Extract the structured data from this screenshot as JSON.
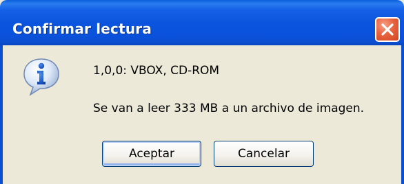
{
  "window": {
    "title": "Confirmar lectura"
  },
  "message": {
    "line1": "1,0,0: VBOX, CD-ROM",
    "line2": "Se van a leer 333 MB a un archivo de imagen."
  },
  "buttons": {
    "accept_label": "Aceptar",
    "cancel_label": "Cancelar"
  },
  "icons": {
    "dialog_icon": "info-icon",
    "close_icon": "close-icon"
  },
  "colors": {
    "titlebar": "#0b55de",
    "close_button": "#e8633f",
    "dialog_background": "#ece9d8"
  }
}
